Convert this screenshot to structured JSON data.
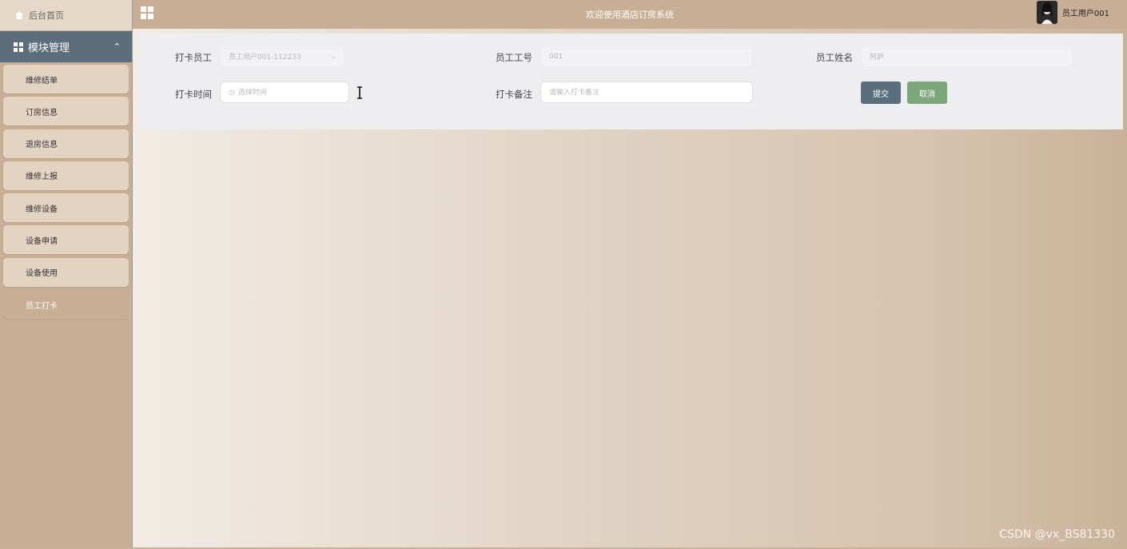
{
  "sidebar": {
    "home_label": "后台首页",
    "module_label": "模块管理",
    "items": [
      {
        "label": "维修结单"
      },
      {
        "label": "订房信息"
      },
      {
        "label": "退房信息"
      },
      {
        "label": "维修上报"
      },
      {
        "label": "维修设备"
      },
      {
        "label": "设备申请"
      },
      {
        "label": "设备使用"
      },
      {
        "label": "员工打卡"
      }
    ]
  },
  "topbar": {
    "title": "欢迎使用酒店订房系统",
    "username": "员工用户001"
  },
  "form": {
    "employee_label": "打卡员工",
    "employee_value": "员工用户001-112233",
    "employee_no_label": "员工工号",
    "employee_no_value": "001",
    "employee_name_label": "员工姓名",
    "employee_name_value": "阿萨",
    "time_label": "打卡时间",
    "time_placeholder": "选择时间",
    "remark_label": "打卡备注",
    "remark_placeholder": "请输入打卡备注",
    "submit_label": "提交",
    "cancel_label": "取消"
  },
  "watermark": "CSDN @vx_BS81330",
  "colors": {
    "accent": "#c8ae95",
    "module_header": "#5c6e7b",
    "submit": "#5a6e7c",
    "cancel": "#7ea67b"
  }
}
